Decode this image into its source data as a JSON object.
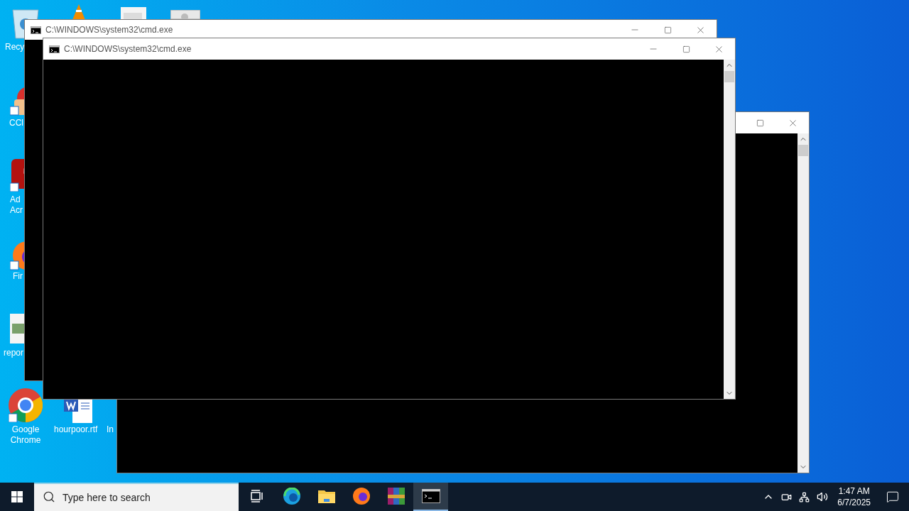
{
  "desktop_icons": [
    {
      "kind": "recycle",
      "lines": [
        "Recy"
      ]
    },
    {
      "kind": "cleaner",
      "lines": [
        "CCl"
      ]
    },
    {
      "kind": "acrobat",
      "lines": [
        "Ad",
        "Acr"
      ]
    },
    {
      "kind": "firefox",
      "lines": [
        "Fir"
      ]
    },
    {
      "kind": "image",
      "lines": [
        "repor"
      ]
    },
    {
      "kind": "chrome",
      "lines": [
        "Google",
        "Chrome"
      ]
    },
    {
      "kind": "word",
      "lines": [
        "hourpoor.rtf"
      ]
    },
    {
      "kind": "blank",
      "lines": [
        "In"
      ]
    },
    {
      "kind": "vlc"
    },
    {
      "kind": "document"
    },
    {
      "kind": "settings-window"
    }
  ],
  "windows": [
    {
      "kind": "console"
    },
    {
      "kind": "console",
      "title": "C:\\WINDOWS\\system32\\cmd.exe"
    },
    {
      "kind": "console",
      "title": "C:\\WINDOWS\\system32\\cmd.exe"
    }
  ],
  "taskbar": {
    "search": {
      "placeholder": "Type here to search"
    },
    "apps": [
      {
        "kind": "task-view",
        "selected": false
      },
      {
        "kind": "edge",
        "selected": false
      },
      {
        "kind": "explorer",
        "selected": false
      },
      {
        "kind": "firefox",
        "selected": false
      },
      {
        "kind": "winrar",
        "selected": false
      },
      {
        "kind": "terminal",
        "selected": true
      }
    ],
    "clock": {
      "time": "1:47 AM",
      "date": "6/7/2025"
    }
  }
}
